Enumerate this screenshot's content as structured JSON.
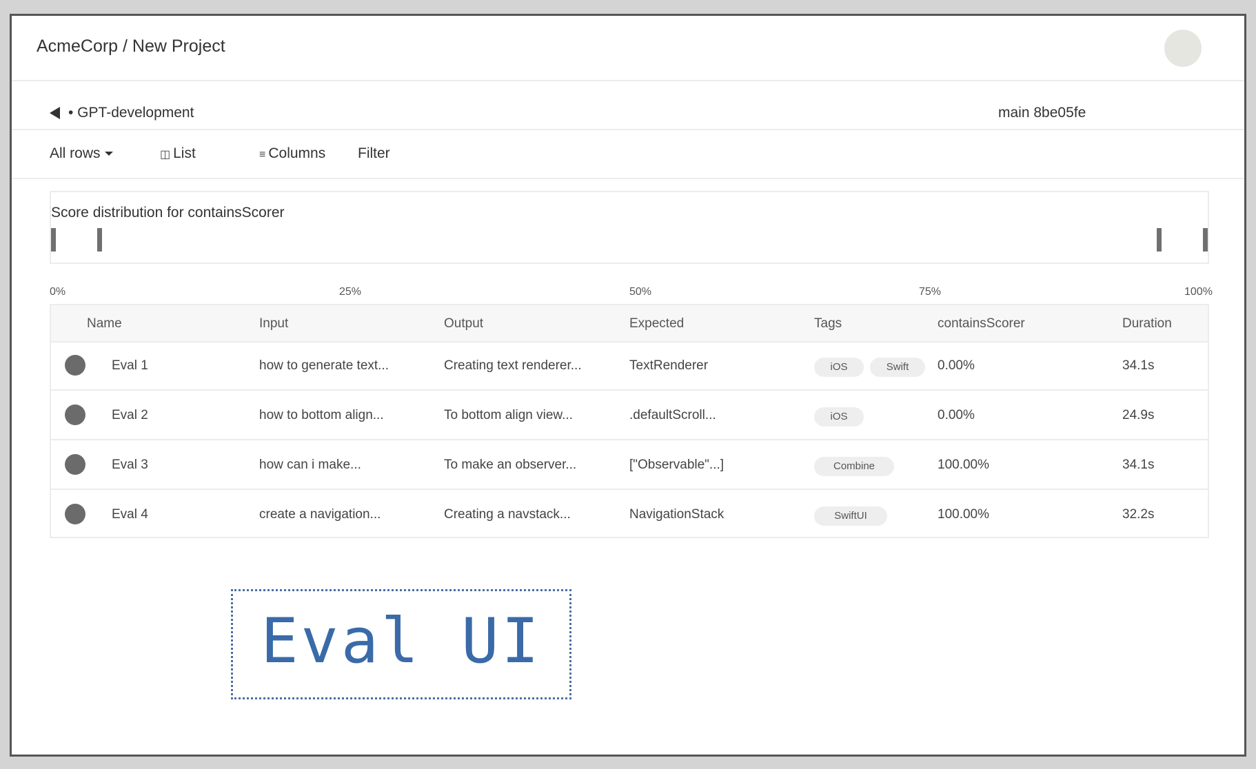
{
  "header": {
    "title": "AcmeCorp / New Project"
  },
  "subheader": {
    "branch_label": "• GPT-development",
    "commit": "main 8be05fe"
  },
  "toolbar": {
    "rows_label": "All rows",
    "list_icon": "◫",
    "list_label": "List",
    "columns_icon": "≡",
    "columns_label": "Columns",
    "filter_label": "Filter"
  },
  "distribution": {
    "title": "Score distribution for containsScorer",
    "axis": [
      "0%",
      "25%",
      "50%",
      "75%",
      "100%"
    ],
    "markers": [
      0.0,
      0.04,
      0.96,
      1.0
    ]
  },
  "table": {
    "headers": [
      "Name",
      "Input",
      "Output",
      "Expected",
      "Tags",
      "containsScorer",
      "Duration"
    ],
    "rows": [
      {
        "name": "Eval 1",
        "input": "how to generate text...",
        "output": "Creating text renderer...",
        "expected": "TextRenderer",
        "tags": [
          "iOS",
          "Swift"
        ],
        "score": "0.00%",
        "duration": "34.1s"
      },
      {
        "name": "Eval 2",
        "input": "how to bottom align...",
        "output": "To bottom align view...",
        "expected": ".defaultScroll...",
        "tags": [
          "iOS"
        ],
        "score": "0.00%",
        "duration": "24.9s"
      },
      {
        "name": "Eval 3",
        "input": "how can i make...",
        "output": "To make an observer...",
        "expected": "[\"Observable\"...]",
        "tags": [
          "Combine"
        ],
        "score": "100.00%",
        "duration": "34.1s"
      },
      {
        "name": "Eval 4",
        "input": "create a navigation...",
        "output": "Creating a navstack...",
        "expected": "NavigationStack",
        "tags": [
          "SwiftUI"
        ],
        "score": "100.00%",
        "duration": "32.2s"
      }
    ]
  },
  "stamp": {
    "text": "Eval UI"
  },
  "colors": {
    "stamp": "#3a6aa8",
    "status_dot": "#6b6b6b"
  }
}
